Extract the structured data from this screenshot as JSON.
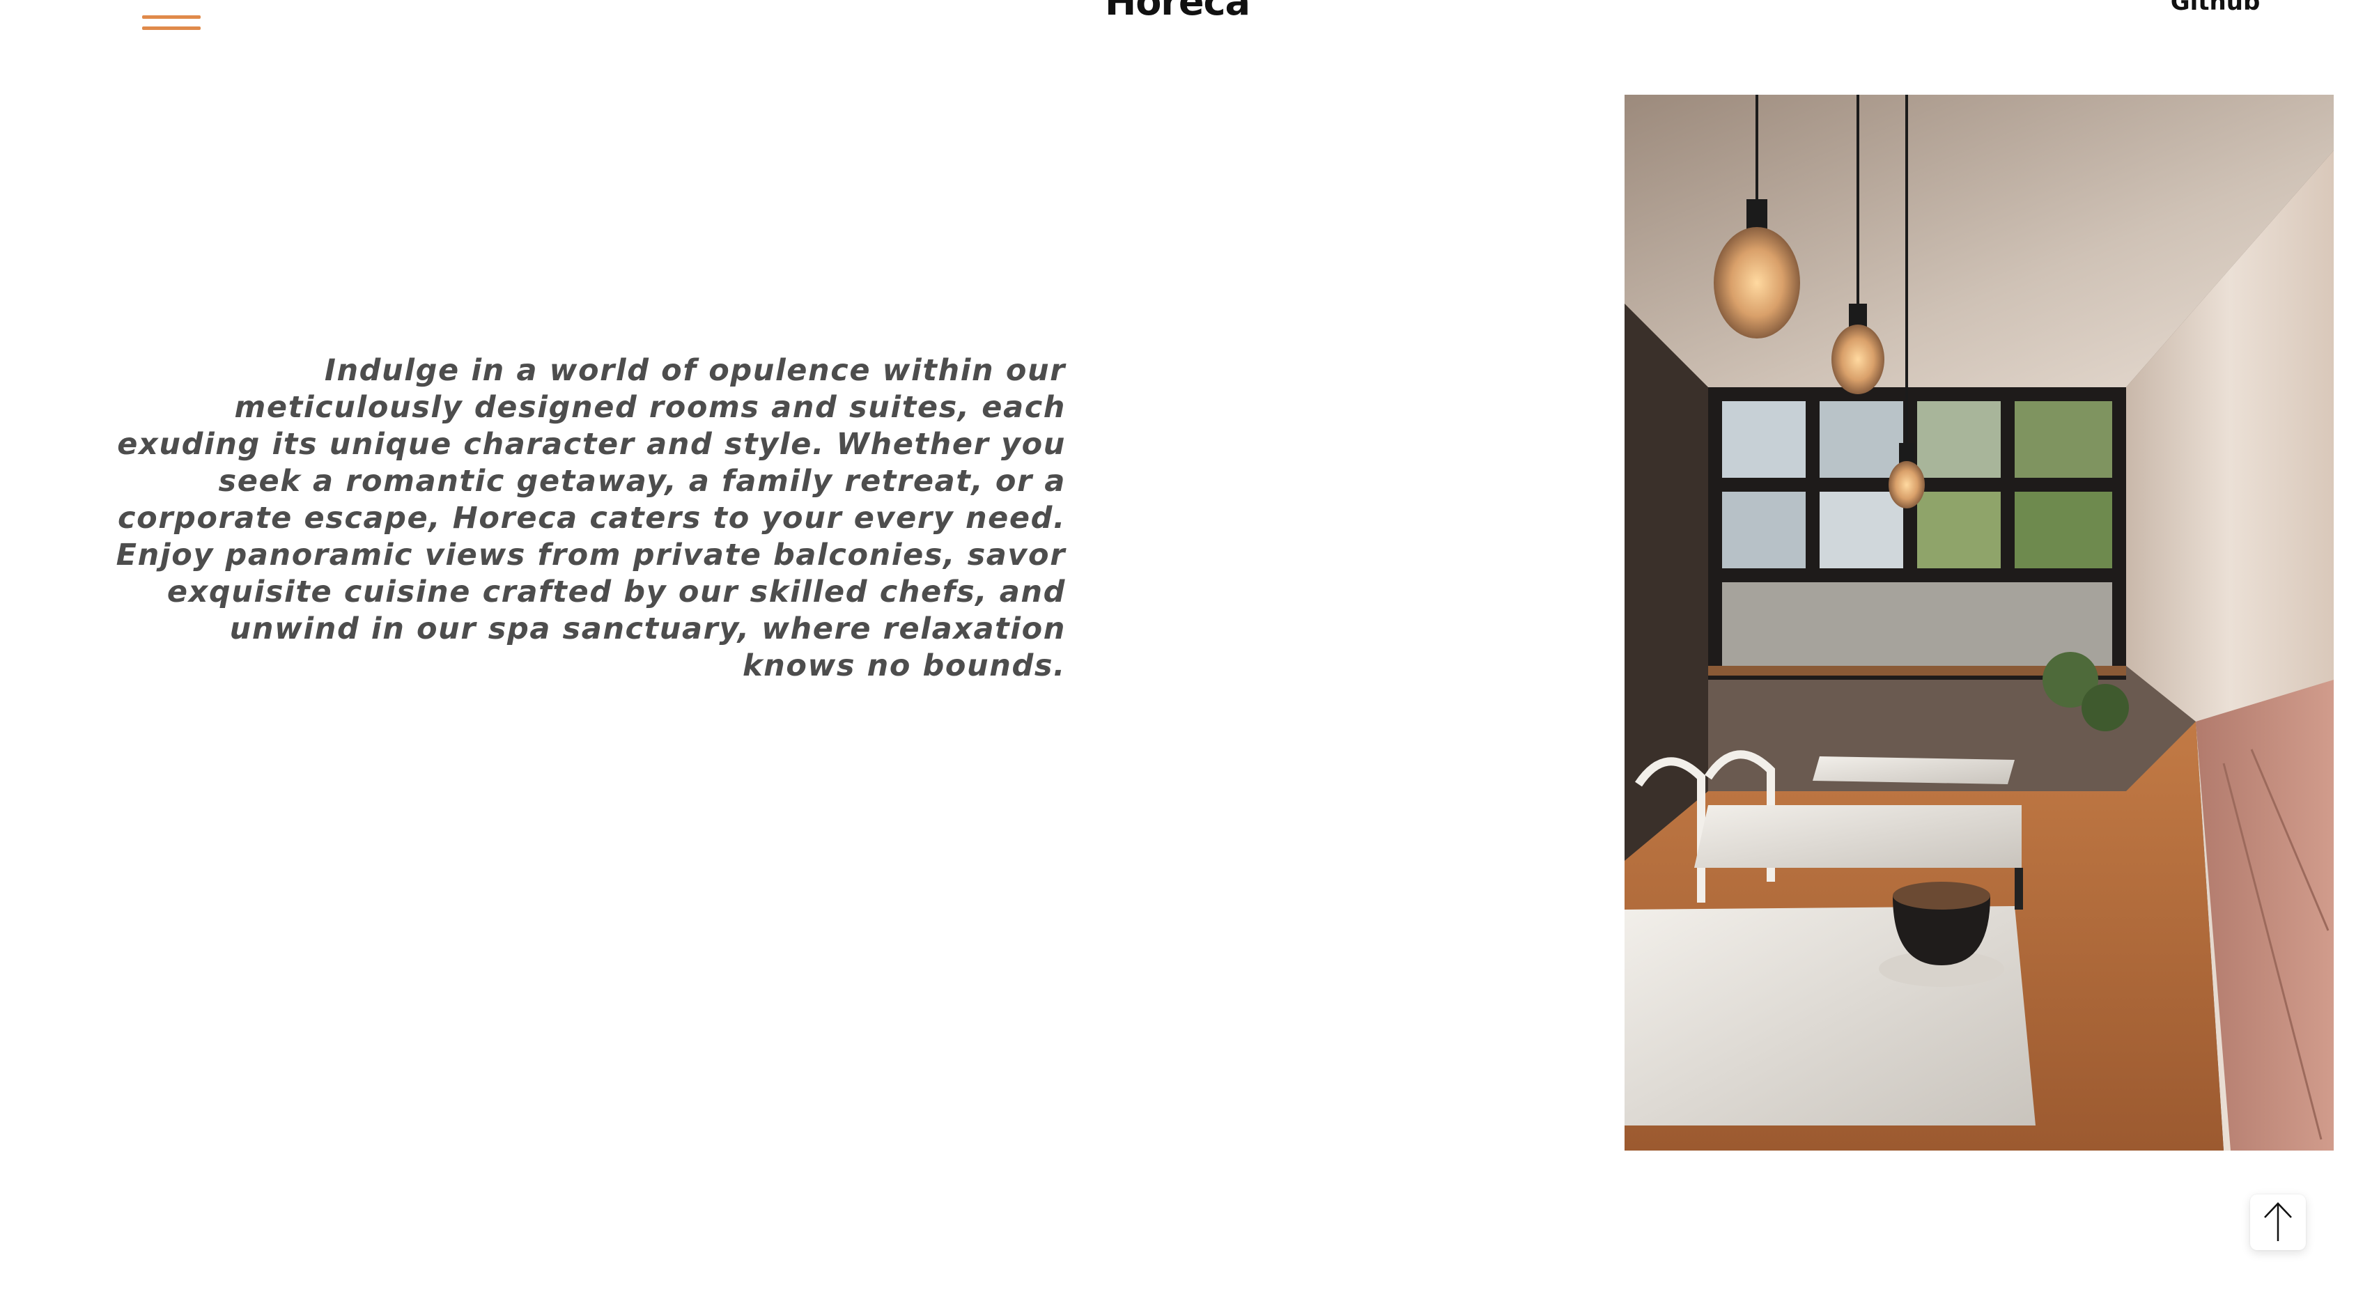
{
  "header": {
    "brand": "Horeca",
    "github_label": "Github",
    "menu_icon": "menu-icon"
  },
  "intro": {
    "text": "Indulge in a world of opulence within our meticulously designed rooms and suites, each exuding its unique character and style. Whether you seek a romantic getaway, a family retreat, or a corporate escape, Horeca caters to your every need. Enjoy panoramic views from private balconies, savor exquisite cuisine crafted by our skilled chefs, and unwind in our spa sanctuary, where relaxation knows no bounds."
  },
  "photo": {
    "subject": "cafe-interior-photo"
  },
  "back_to_top": {
    "icon": "arrow-up-icon"
  },
  "colors": {
    "accent": "#e08a4a",
    "text": "#4d4d4d",
    "brand_text": "#111111",
    "background": "#ffffff"
  }
}
